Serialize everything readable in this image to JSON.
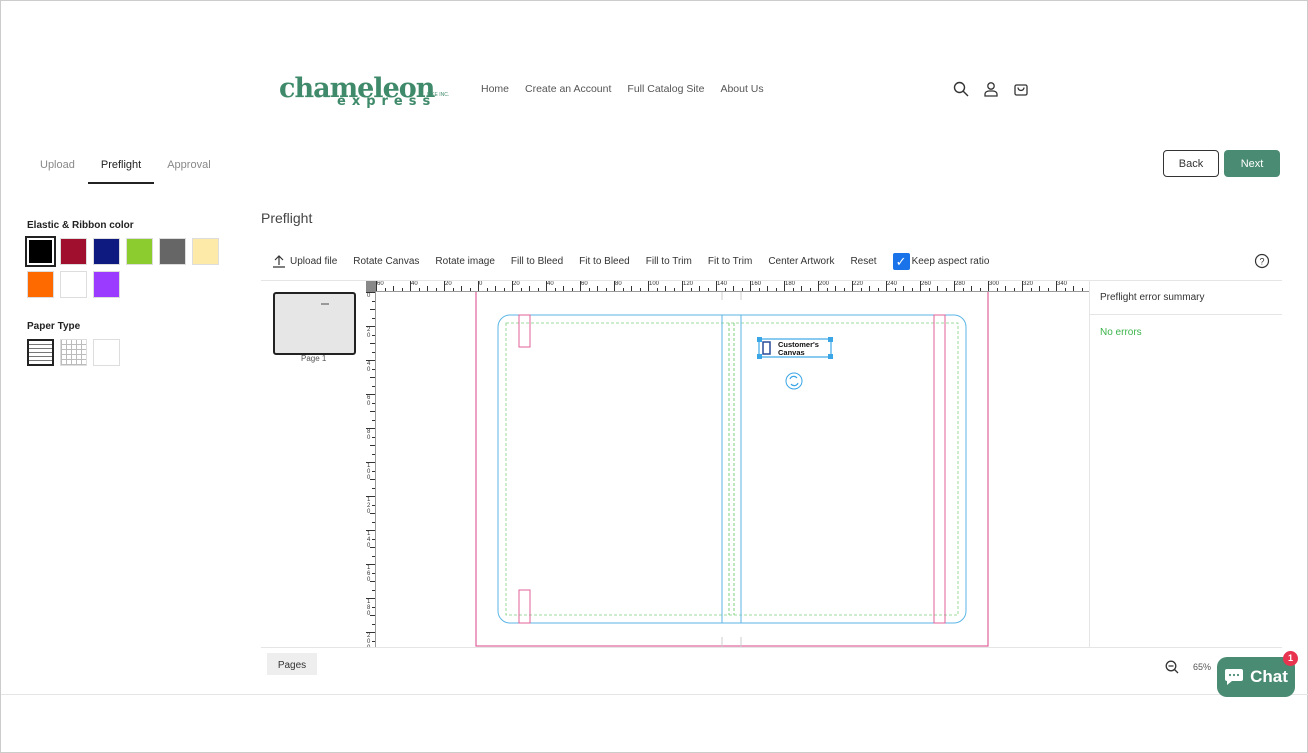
{
  "brand": {
    "name": "chameleon",
    "sub": "express",
    "tag": "LIKE INC."
  },
  "nav": [
    "Home",
    "Create an Account",
    "Full Catalog Site",
    "About Us"
  ],
  "header_icons": [
    "search-icon",
    "user-icon",
    "cart-icon"
  ],
  "steps": {
    "items": [
      "Upload",
      "Preflight",
      "Approval"
    ],
    "active": "Preflight"
  },
  "actions": {
    "back": "Back",
    "next": "Next"
  },
  "options": {
    "ribbon_label": "Elastic & Ribbon color",
    "ribbon_colors": [
      "#000000",
      "#a0102e",
      "#0f1a80",
      "#8dcc2e",
      "#666666",
      "#fde9a8",
      "#ff6a00",
      "#ffffff",
      "#9b3bff"
    ],
    "ribbon_selected": "#000000",
    "paper_label": "Paper Type",
    "paper_types": [
      "lined",
      "grid",
      "blank"
    ],
    "paper_selected": "lined"
  },
  "page_title": "Preflight",
  "toolbar": {
    "upload": "Upload file",
    "items": [
      "Rotate Canvas",
      "Rotate image",
      "Fill to Bleed",
      "Fit to Bleed",
      "Fill to Trim",
      "Fit to Trim",
      "Center Artwork",
      "Reset"
    ],
    "keep_aspect": "Keep aspect ratio",
    "keep_aspect_checked": true
  },
  "pages": {
    "thumb_label": "Page 1",
    "tab": "Pages"
  },
  "ruler": {
    "top": [
      "60",
      "40",
      "20",
      "0",
      "20",
      "40",
      "60",
      "80",
      "100",
      "120",
      "140",
      "160",
      "180",
      "200",
      "220",
      "240",
      "260",
      "280",
      "300",
      "320",
      "340"
    ],
    "left": [
      "0",
      "20",
      "40",
      "60",
      "80",
      "100",
      "120",
      "140",
      "160",
      "180",
      "200"
    ]
  },
  "artwork": {
    "line1": "Customer's",
    "line2": "Canvas"
  },
  "preflight": {
    "title": "Preflight error summary",
    "status": "No errors",
    "status_color": "#3cb44b"
  },
  "zoom": {
    "value": "65%"
  },
  "chat": {
    "label": "Chat",
    "badge": "1"
  }
}
